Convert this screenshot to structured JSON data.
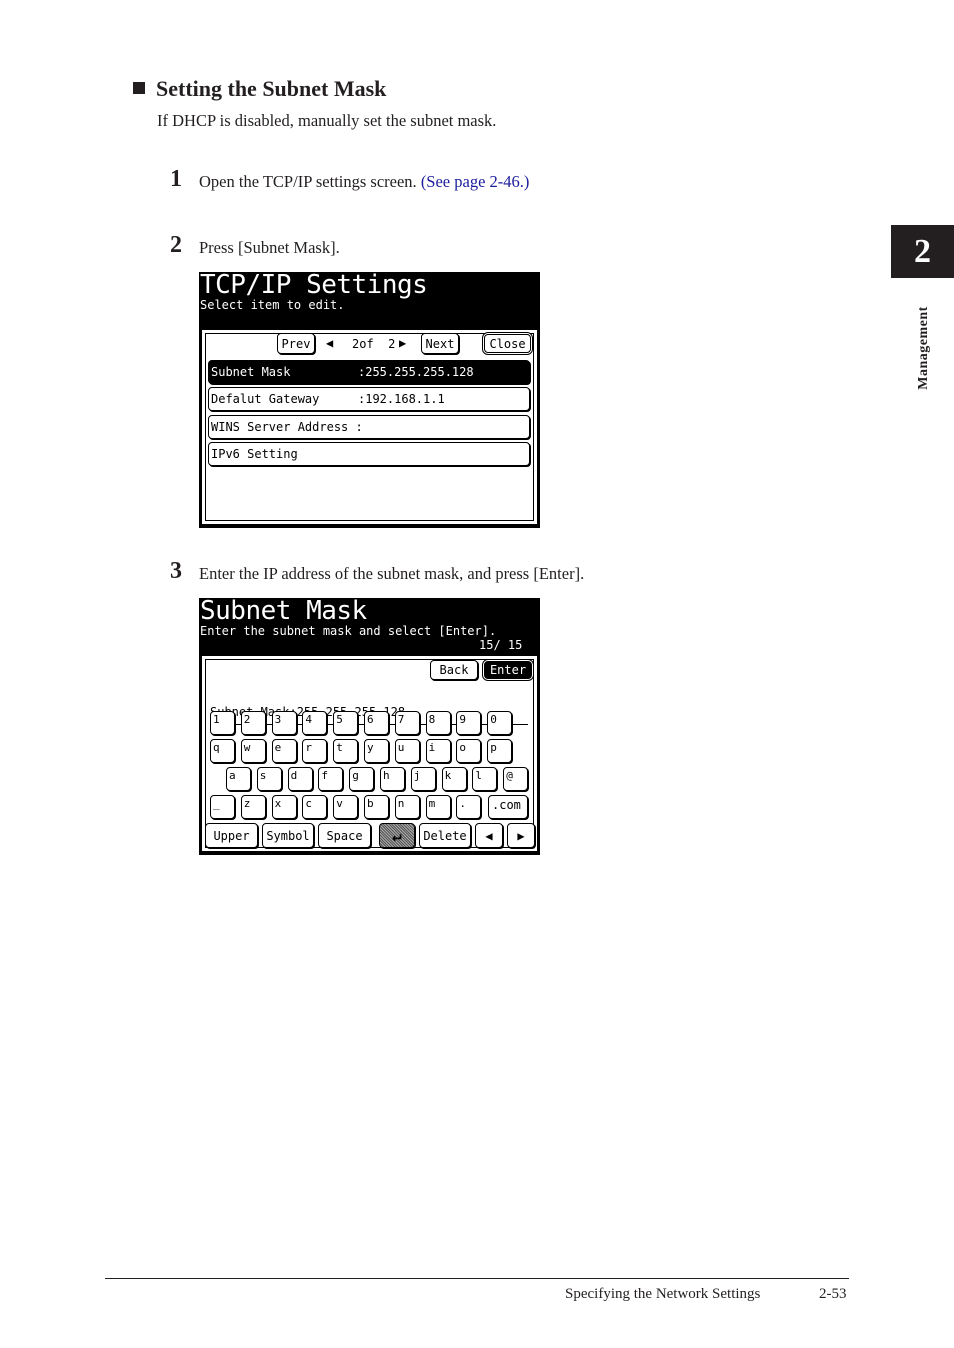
{
  "section": {
    "title": "Setting the Subnet Mask",
    "intro": "If DHCP is disabled, manually set the subnet mask."
  },
  "steps": [
    {
      "number": "1",
      "text": "Open the TCP/IP settings screen. ",
      "link": "(See page 2-46.)"
    },
    {
      "number": "2",
      "text": "Press [Subnet Mask]."
    },
    {
      "number": "3",
      "text": "Enter the IP address of the subnet mask, and press [Enter]."
    }
  ],
  "side_tab": {
    "chapter": "2",
    "label": "Management"
  },
  "footer": {
    "title": "Specifying the Network Settings",
    "page": "2-53"
  },
  "screen1": {
    "title": "TCP/IP Settings",
    "subtitle": "Select item to edit.",
    "prev_label": "Prev",
    "page_indicator": "2of  2",
    "next_label": "Next",
    "close_label": "Close",
    "items": [
      {
        "label": "Subnet Mask",
        "value": ":255.255.255.128",
        "selected": true
      },
      {
        "label": "Defalut Gateway",
        "value": ":192.168.1.1",
        "selected": false
      },
      {
        "label": "WINS Server Address :",
        "value": "",
        "selected": false
      },
      {
        "label": "IPv6 Setting",
        "value": "",
        "selected": false
      }
    ]
  },
  "screen2": {
    "title": "Subnet Mask",
    "subtitle": "Enter the subnet mask and select [Enter].",
    "char_count": "15/ 15",
    "back_label": "Back",
    "enter_label": "Enter",
    "field_label": "Subnet Mask:",
    "field_value": "255.255.255.128",
    "keyboard": {
      "row1": [
        "1",
        "2",
        "3",
        "4",
        "5",
        "6",
        "7",
        "8",
        "9",
        "0"
      ],
      "row2": [
        "q",
        "w",
        "e",
        "r",
        "t",
        "y",
        "u",
        "i",
        "o",
        "p"
      ],
      "row3": [
        "a",
        "s",
        "d",
        "f",
        "g",
        "h",
        "j",
        "k",
        "l",
        "@"
      ],
      "row4": [
        "_",
        "z",
        "x",
        "c",
        "v",
        "b",
        "n",
        "m",
        "."
      ],
      "dotcom": ".com",
      "upper": "Upper",
      "symbol": "Symbol",
      "space": "Space",
      "delete": "Delete"
    }
  }
}
